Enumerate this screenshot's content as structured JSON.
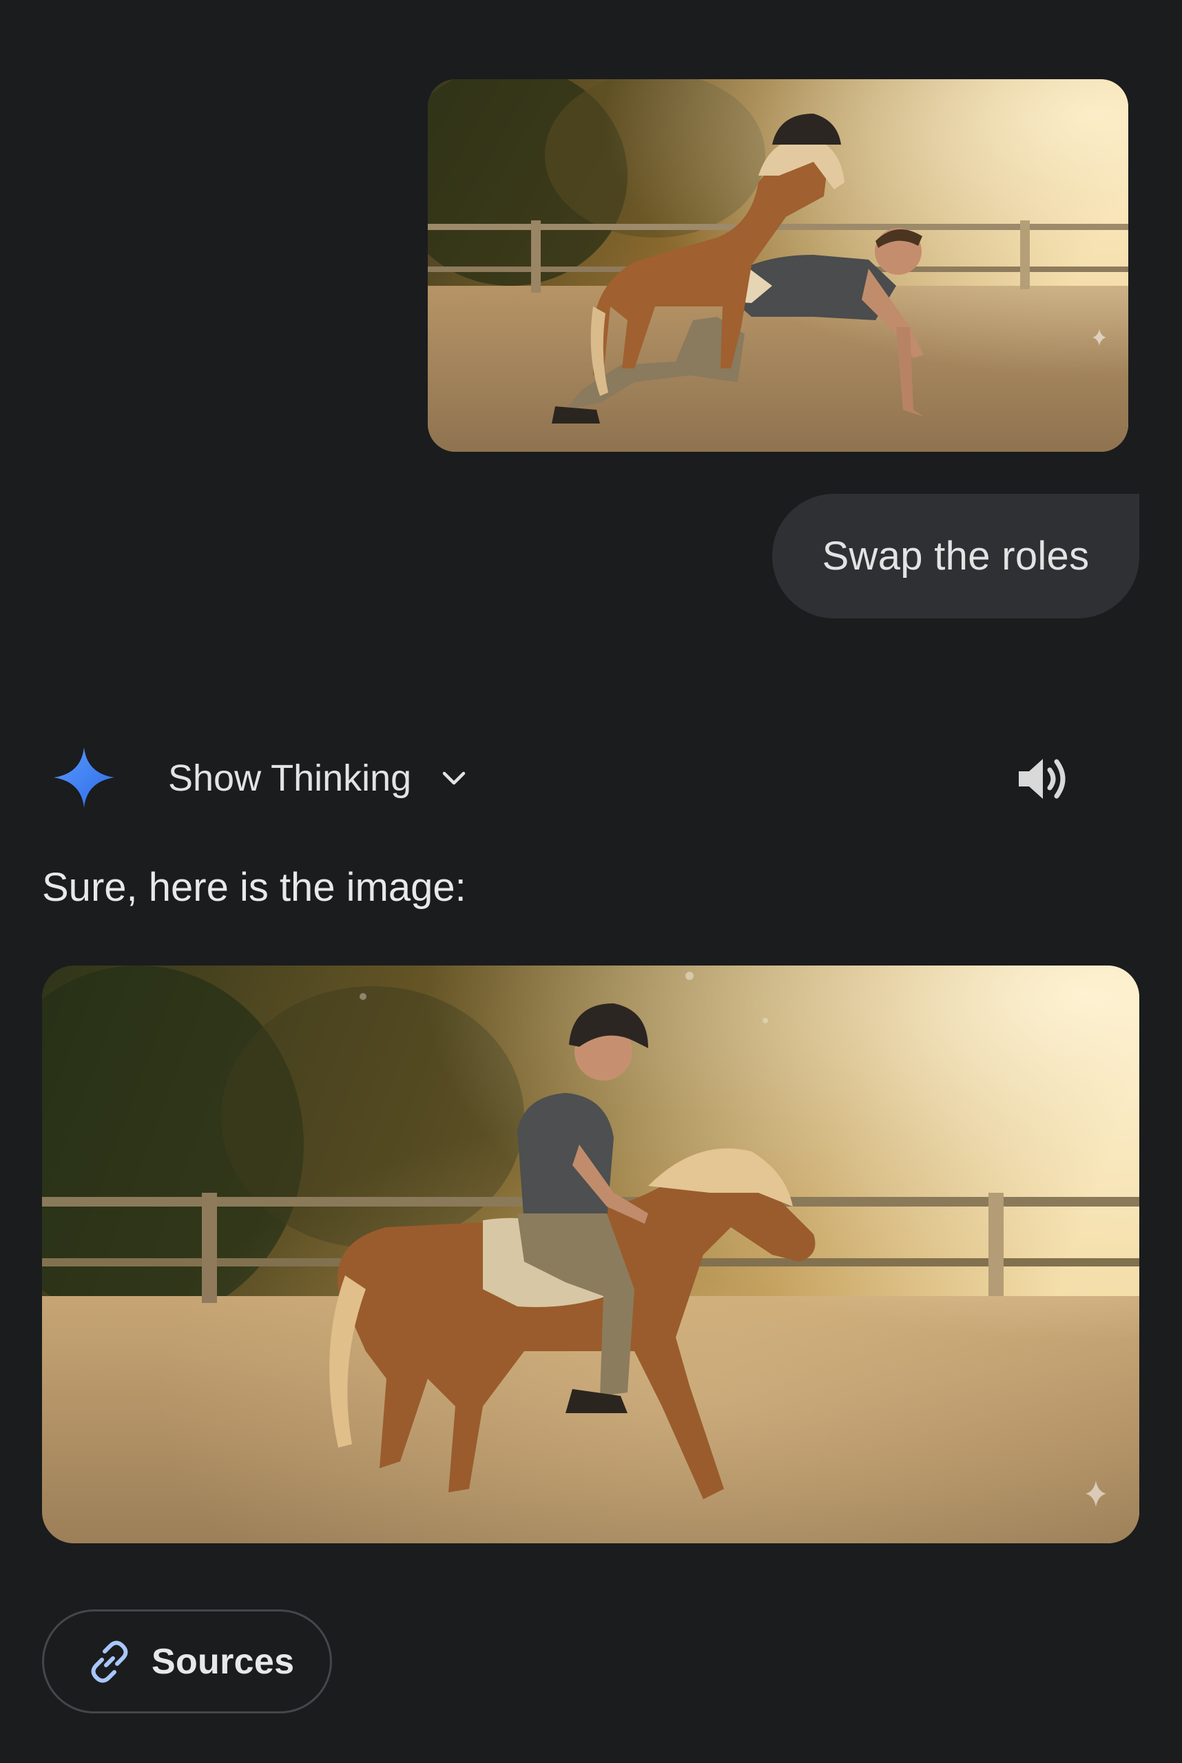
{
  "user_message": {
    "image_alt": "Pony wearing a riding helmet standing on a kneeling man in a sandy riding arena",
    "text": "Swap the roles"
  },
  "response": {
    "thinking_label": "Show Thinking",
    "body_text": "Sure, here is the image:",
    "image_alt": "Man in a helmet riding a small chestnut pony in a sandy riding arena at golden hour",
    "sources_label": "Sources"
  },
  "icons": {
    "assistant": "sparkle-icon",
    "expand": "chevron-down-icon",
    "read_aloud": "speaker-icon",
    "sources": "link-icon",
    "watermark": "sparkle-watermark-icon"
  },
  "colors": {
    "background": "#1b1c1e",
    "bubble": "#2f3033",
    "gemini_blue": "#4285f4",
    "link_blue": "#a8c7fa"
  }
}
